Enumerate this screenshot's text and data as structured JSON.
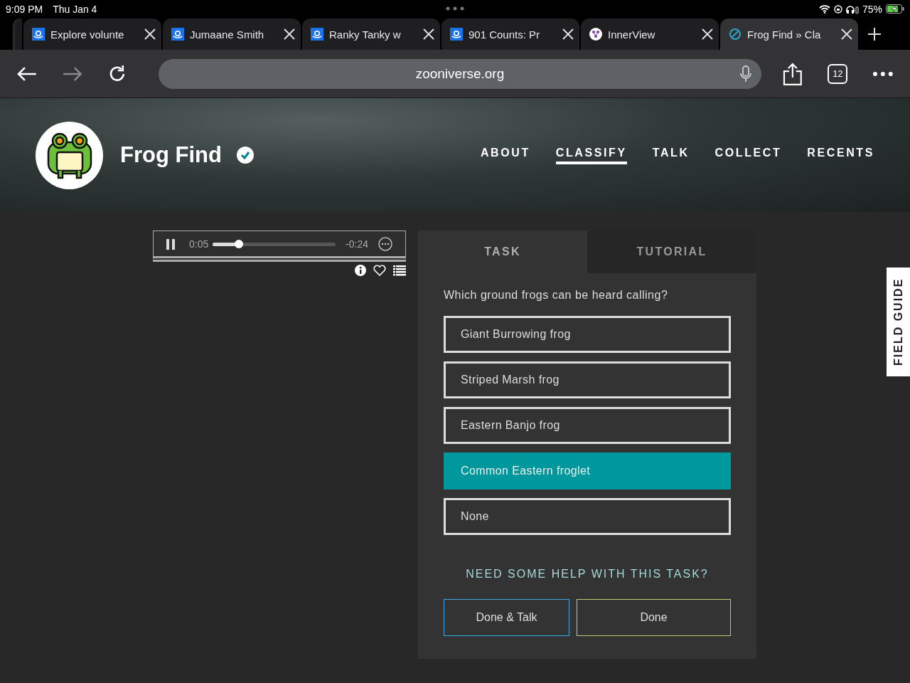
{
  "status_bar": {
    "time": "9:09 PM",
    "date": "Thu Jan 4",
    "battery": "75%"
  },
  "tabs": [
    {
      "title": "Explore volunte",
      "kind": "zooniverse",
      "selected": false
    },
    {
      "title": "Jumaane Smith",
      "kind": "zooniverse",
      "selected": false
    },
    {
      "title": "Ranky Tanky w",
      "kind": "zooniverse",
      "selected": false
    },
    {
      "title": "901 Counts: Pr",
      "kind": "zooniverse",
      "selected": false
    },
    {
      "title": "InnerView",
      "kind": "innerview",
      "selected": false
    },
    {
      "title": "Frog Find » Cla",
      "kind": "compass",
      "selected": true
    }
  ],
  "address_bar": {
    "url": "zooniverse.org",
    "tab_count": "12"
  },
  "project": {
    "name": "Frog Find",
    "verified": true,
    "nav": [
      {
        "label": "ABOUT",
        "selected": false
      },
      {
        "label": "CLASSIFY",
        "selected": true
      },
      {
        "label": "TALK",
        "selected": false
      },
      {
        "label": "COLLECT",
        "selected": false
      },
      {
        "label": "RECENTS",
        "selected": false
      }
    ]
  },
  "player": {
    "elapsed": "0:05",
    "remaining": "-0:24",
    "level": 0.21
  },
  "panel_tabs": [
    {
      "label": "TASK",
      "selected": true
    },
    {
      "label": "TUTORIAL",
      "selected": false
    }
  ],
  "task": {
    "question": "Which ground frogs can be heard calling?",
    "answers": [
      {
        "label": "Giant Burrowing frog",
        "selected": false
      },
      {
        "label": "Striped Marsh frog",
        "selected": false
      },
      {
        "label": "Eastern Banjo frog",
        "selected": false
      },
      {
        "label": "Common Eastern froglet",
        "selected": true
      },
      {
        "label": "None",
        "selected": false
      }
    ],
    "help": "NEED SOME HELP WITH THIS TASK?",
    "buttons": [
      {
        "label": "Done & Talk",
        "kind": "talk"
      },
      {
        "label": "Done",
        "kind": "done"
      }
    ]
  },
  "field_guide": "FIELD GUIDE"
}
